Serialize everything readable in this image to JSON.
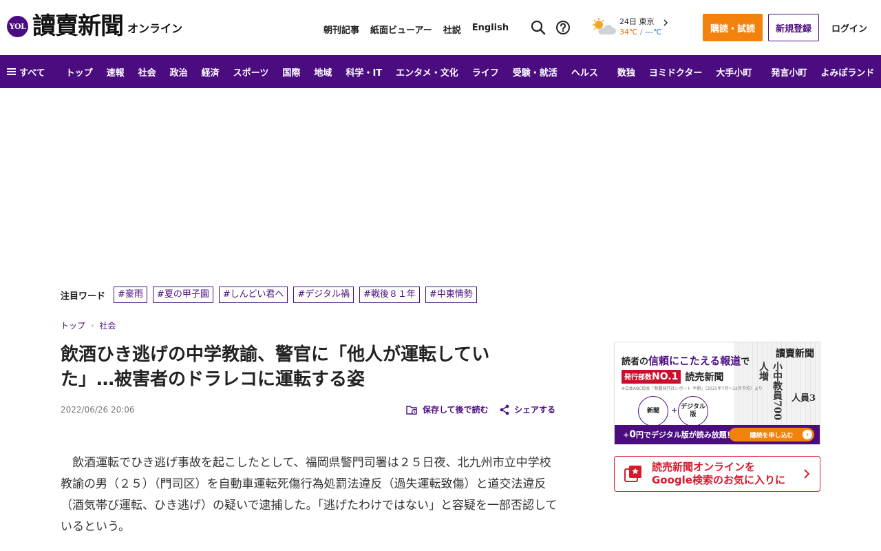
{
  "header": {
    "logo_badge": "YOL",
    "logo_text": "讀賣新聞",
    "logo_sub": "オンライン",
    "links": [
      "朝刊記事",
      "紙面ビューアー",
      "社説",
      "English"
    ],
    "weather": {
      "date_place": "24日 東京",
      "temp_high": "34℃",
      "temp_sep": "/",
      "temp_low": "---℃"
    },
    "subscribe_label": "購読・試読",
    "register_label": "新規登録",
    "login_label": "ログイン"
  },
  "nav": {
    "all_label": "すべて",
    "group1": [
      "トップ",
      "速報",
      "社会",
      "政治",
      "経済",
      "スポーツ",
      "国際",
      "地域",
      "科学・IT",
      "エンタメ・文化",
      "ライフ",
      "受験・就活",
      "ヘルス"
    ],
    "group2": [
      "数独",
      "ヨミドクター",
      "大手小町"
    ],
    "group3": [
      "発言小町",
      "よみぽランド"
    ]
  },
  "trending": {
    "label": "注目ワード",
    "tags": [
      "#豪雨",
      "#夏の甲子園",
      "#しんどい君へ",
      "#デジタル禍",
      "#戦後８１年",
      "#中東情勢"
    ]
  },
  "breadcrumb": [
    "トップ",
    "社会"
  ],
  "article": {
    "title": "飲酒ひき逃げの中学教諭、警官に「他人が運転していた」…被害者のドラレコに運転する姿",
    "date": "2022/06/26 20:06",
    "save_label": "保存して後で読む",
    "share_label": "シェアする",
    "body": "飲酒運転でひき逃げ事故を起こしたとして、福岡県警門司署は２５日夜、北九州市立中学校教諭の男（２５）（門司区）を自動車運転死傷行為処罰法違反（過失運転致傷）と道交法違反（酒気帯び運転、ひき逃げ）の疑いで逮捕した。「逃げたわけではない」と容疑を一部否認しているという。"
  },
  "sidebar": {
    "promo": {
      "tagline_pre": "読者の",
      "tagline_accent": "信頼にこたえる報道",
      "tagline_post": "で",
      "no1_pre": "発行部数",
      "no1_main": "NO.1",
      "brand": "読売新聞",
      "note": "※日本ABC協会「新聞発行社レポート 半期」（2025年7月～12月平均）より",
      "paper_masthead": "讀賣新聞",
      "paper_headline": "小中教員700人増",
      "paper_headline2": "人員3",
      "circle_newspaper": "新聞",
      "circle_plus": "+",
      "circle_digital": "デジタル版",
      "free_pre": "+",
      "free_num": "0",
      "free_post": "円でデジタル版が読み放題！",
      "cta_label": "購読を申し込む"
    },
    "google_fav": {
      "line1": "読売新聞オンラインを",
      "line2": "Google検索のお気に入りに"
    }
  },
  "colors": {
    "brand_purple": "#4b0c80",
    "accent_orange": "#f3820d",
    "google_red": "#d7192c"
  }
}
